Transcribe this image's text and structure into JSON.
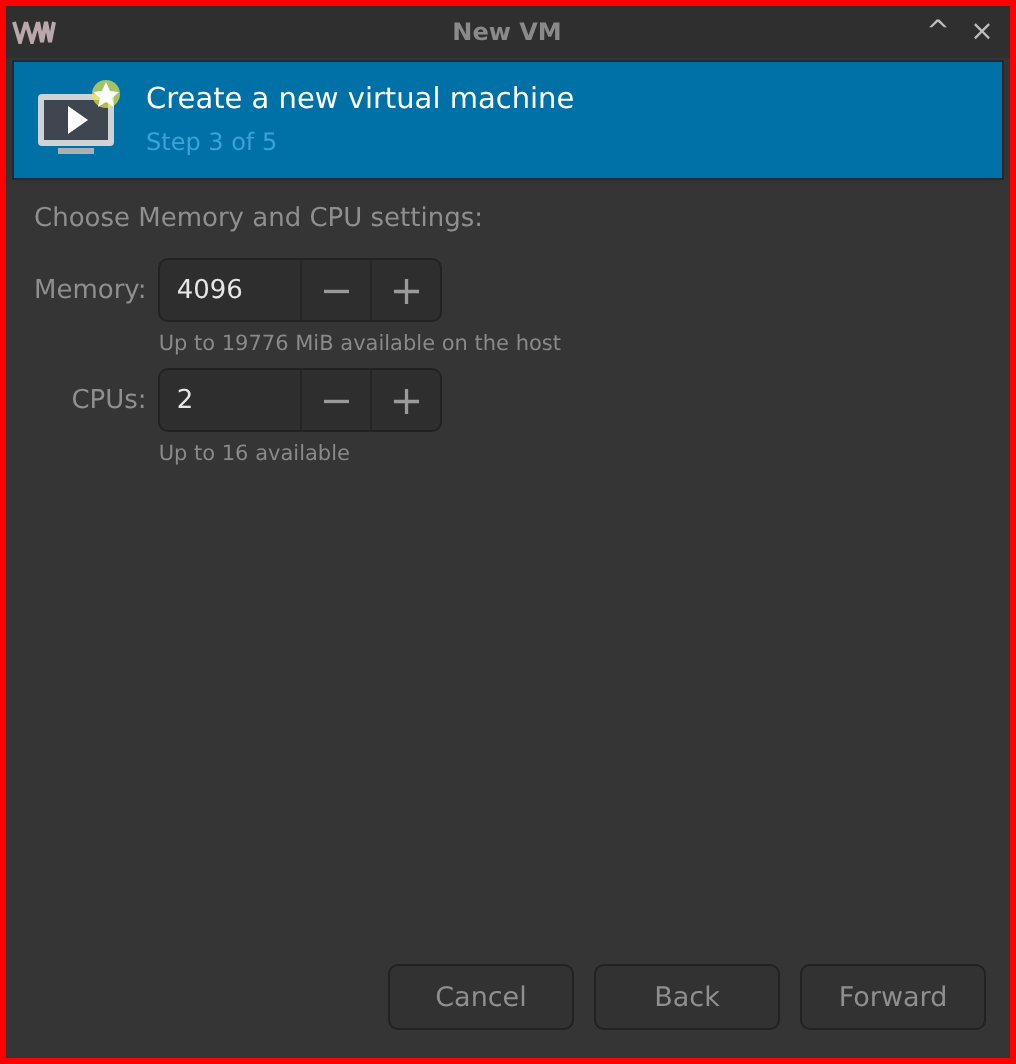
{
  "window": {
    "title": "New VM",
    "controls": [
      "^",
      "×"
    ]
  },
  "header": {
    "title": "Create a new virtual machine",
    "subtitle": "Step 3 of 5"
  },
  "section_label": "Choose Memory and CPU settings:",
  "fields": [
    {
      "label": "Memory:",
      "value": "4096",
      "decrement": "−",
      "increment": "+",
      "hint": "Up to 19776 MiB available on the host"
    },
    {
      "label": "CPUs:",
      "value": "2",
      "decrement": "−",
      "increment": "+",
      "hint": "Up to 16 available"
    }
  ],
  "buttons": [
    "Cancel",
    "Back",
    "Forward"
  ]
}
